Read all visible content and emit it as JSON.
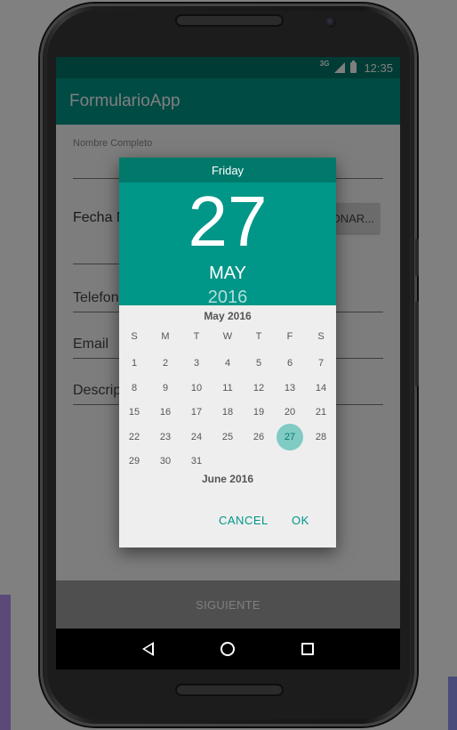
{
  "status_bar": {
    "network": "3G",
    "time": "12:35"
  },
  "app_bar": {
    "title": "FormularioApp"
  },
  "form": {
    "nombre_label": "Nombre Completo",
    "fecha_label": "Fecha N",
    "select_button_label": "ONAR...",
    "telefono_label": "Telefon",
    "email_label": "Email",
    "descripcion_label": "Descrip"
  },
  "bottom_button": {
    "label": "SIGUIENTE"
  },
  "date_picker": {
    "weekday": "Friday",
    "day": "27",
    "month": "MAY",
    "year": "2016",
    "month_title": "May 2016",
    "weekday_headers": [
      "S",
      "M",
      "T",
      "W",
      "T",
      "F",
      "S"
    ],
    "weeks": [
      [
        "1",
        "2",
        "3",
        "4",
        "5",
        "6",
        "7"
      ],
      [
        "8",
        "9",
        "10",
        "11",
        "12",
        "13",
        "14"
      ],
      [
        "15",
        "16",
        "17",
        "18",
        "19",
        "20",
        "21"
      ],
      [
        "22",
        "23",
        "24",
        "25",
        "26",
        "27",
        "28"
      ],
      [
        "29",
        "30",
        "31",
        "",
        "",
        "",
        ""
      ]
    ],
    "selected_day": "27",
    "next_month_title": "June 2016",
    "cancel_label": "CANCEL",
    "ok_label": "OK",
    "accent_color": "#009688",
    "header_dark_color": "#00796b"
  },
  "icons": {
    "nav_back": "back-triangle-icon",
    "nav_home": "home-circle-icon",
    "nav_recents": "recents-square-icon",
    "signal": "signal-icon",
    "battery": "battery-icon"
  }
}
